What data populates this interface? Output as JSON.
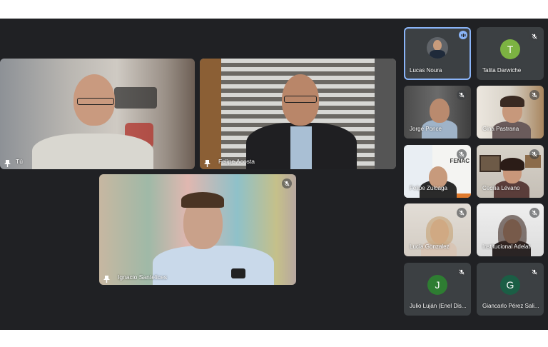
{
  "participants": {
    "main": [
      {
        "name": "Tú"
      },
      {
        "name": "Felipe Acosta"
      },
      {
        "name": "Ignacio Santelices"
      }
    ],
    "side": [
      {
        "name": "Lucas Noura",
        "speaking": true
      },
      {
        "name": "Talita Darwiche",
        "initial": "T",
        "avatar_color": "#7cb342"
      },
      {
        "name": "Jorge Ponce"
      },
      {
        "name": "Gina Pastrana"
      },
      {
        "name": "Felipe Zuloaga",
        "logo_text": "FENAC"
      },
      {
        "name": "Cecilia Lévano"
      },
      {
        "name": "Lucía Gonzalez"
      },
      {
        "name": "Institucional Adelat"
      },
      {
        "name": "Julio Luján (Enel Dis...",
        "initial": "J",
        "avatar_color": "#2e7d32"
      },
      {
        "name": "Giancarlo Pérez Sali...",
        "initial": "G",
        "avatar_color": "#1b5e45"
      }
    ]
  },
  "colors": {
    "background": "#202124",
    "speaking_border": "#8ab4f8"
  }
}
